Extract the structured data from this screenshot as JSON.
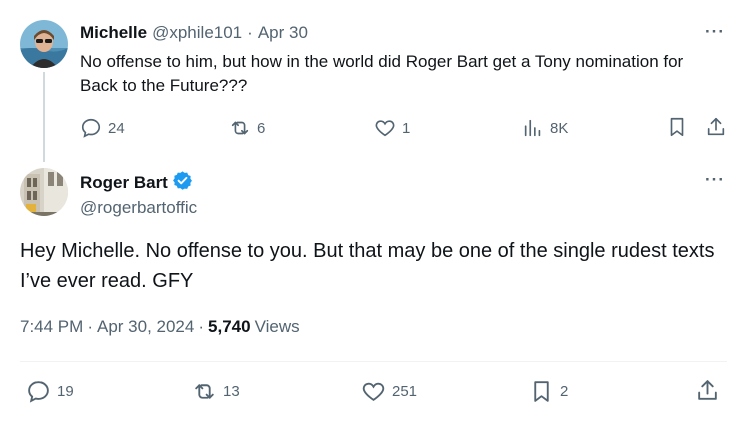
{
  "reply": {
    "author_name": "Michelle",
    "author_handle": "@xphile101",
    "separator": "·",
    "date": "Apr 30",
    "text": "No offense to him, but how in the world did Roger Bart get a Tony nomination for Back to the Future???",
    "more": "···",
    "actions": {
      "replies": "24",
      "reposts": "6",
      "likes": "1",
      "views": "8K"
    }
  },
  "main": {
    "author_name": "Roger Bart",
    "author_handle": "@rogerbartoffic",
    "more": "···",
    "text": "Hey Michelle. No offense to you. But that may be one of the single rudest texts I’ve ever read. GFY",
    "time": "7:44 PM",
    "separator": "·",
    "date": "Apr 30, 2024",
    "separator2": "·",
    "views_count": "5,740",
    "views_label": "Views",
    "actions": {
      "replies": "19",
      "reposts": "13",
      "likes": "251",
      "bookmarks": "2"
    }
  },
  "colors": {
    "verified": "#1d9bf0",
    "muted": "#536471",
    "text": "#0f1419"
  }
}
